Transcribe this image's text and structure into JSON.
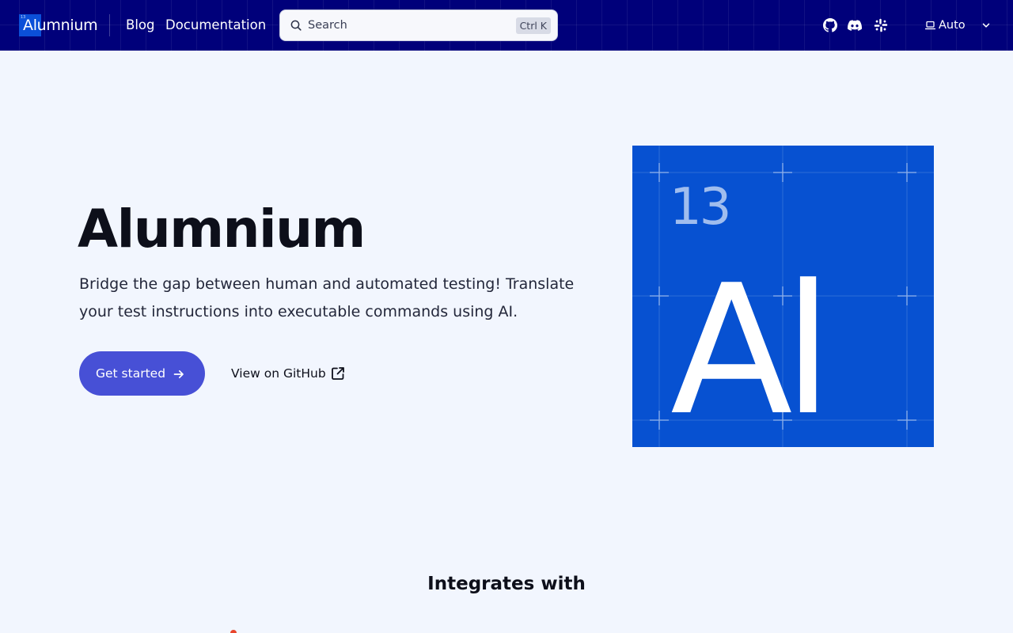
{
  "header": {
    "logo_text": "Alumnium",
    "logo_mark_number": "13",
    "nav": {
      "blog": "Blog",
      "docs": "Documentation"
    },
    "search": {
      "placeholder": "Search",
      "shortcut": "Ctrl K"
    },
    "social": [
      "github-icon",
      "discord-icon",
      "slack-icon"
    ],
    "theme": {
      "label": "Auto",
      "icon": "laptop-icon"
    }
  },
  "hero": {
    "title": "Alumnium",
    "tagline": "Bridge the gap between human and automated testing! Translate your test instructions into executable commands using AI.",
    "primary_cta": "Get started",
    "secondary_cta": "View on GitHub"
  },
  "element_tile": {
    "number": "13",
    "symbol": "Al",
    "color": "#0751d1"
  },
  "integrates": {
    "title": "Integrates with"
  },
  "colors": {
    "header_bg": "#00007a",
    "page_bg": "#f2f6fe",
    "primary_button": "#4750d6",
    "accent": "#0b4fd8"
  }
}
